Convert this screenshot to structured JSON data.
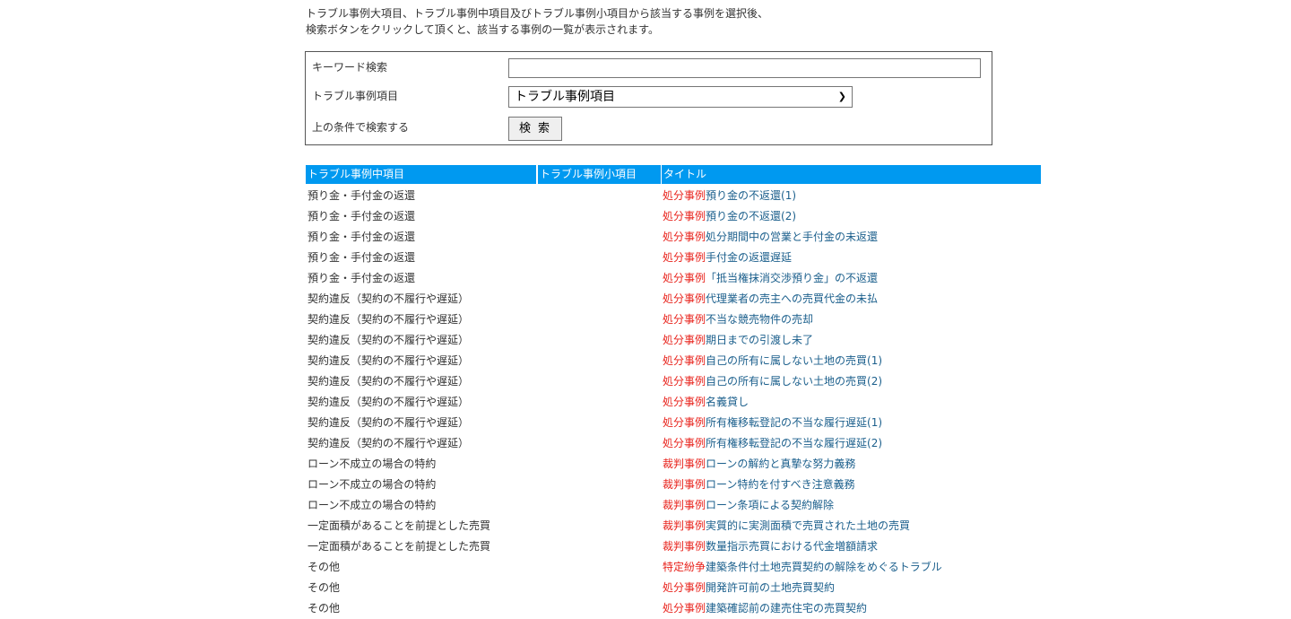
{
  "intro": {
    "line1": "トラブル事例大項目、トラブル事例中項目及びトラブル事例小項目から該当する事例を選択後、",
    "line2": "検索ボタンをクリックして頂くと、該当する事例の一覧が表示されます。"
  },
  "search": {
    "keyword_label": "キーワード検索",
    "keyword_value": "",
    "category_label": "トラブル事例項目",
    "category_selected": "トラブル事例項目",
    "submit_label": "上の条件で検索する",
    "button_label": "検索"
  },
  "table": {
    "headers": [
      "トラブル事例中項目",
      "トラブル事例小項目",
      "タイトル"
    ],
    "rows": [
      {
        "mid": "預り金・手付金の返還",
        "small": "",
        "type": "処分事例",
        "title": "預り金の不返還(1)"
      },
      {
        "mid": "預り金・手付金の返還",
        "small": "",
        "type": "処分事例",
        "title": "預り金の不返還(2)"
      },
      {
        "mid": "預り金・手付金の返還",
        "small": "",
        "type": "処分事例",
        "title": "処分期間中の営業と手付金の未返還"
      },
      {
        "mid": "預り金・手付金の返還",
        "small": "",
        "type": "処分事例",
        "title": "手付金の返還遅延"
      },
      {
        "mid": "預り金・手付金の返還",
        "small": "",
        "type": "処分事例",
        "title": "「抵当権抹消交渉預り金」の不返還"
      },
      {
        "mid": "契約違反（契約の不履行や遅延）",
        "small": "",
        "type": "処分事例",
        "title": "代理業者の売主への売買代金の未払"
      },
      {
        "mid": "契約違反（契約の不履行や遅延）",
        "small": "",
        "type": "処分事例",
        "title": "不当な競売物件の売却"
      },
      {
        "mid": "契約違反（契約の不履行や遅延）",
        "small": "",
        "type": "処分事例",
        "title": "期日までの引渡し未了"
      },
      {
        "mid": "契約違反（契約の不履行や遅延）",
        "small": "",
        "type": "処分事例",
        "title": "自己の所有に属しない土地の売買(1)"
      },
      {
        "mid": "契約違反（契約の不履行や遅延）",
        "small": "",
        "type": "処分事例",
        "title": "自己の所有に属しない土地の売買(2)"
      },
      {
        "mid": "契約違反（契約の不履行や遅延）",
        "small": "",
        "type": "処分事例",
        "title": "名義貸し"
      },
      {
        "mid": "契約違反（契約の不履行や遅延）",
        "small": "",
        "type": "処分事例",
        "title": "所有権移転登記の不当な履行遅延(1)"
      },
      {
        "mid": "契約違反（契約の不履行や遅延）",
        "small": "",
        "type": "処分事例",
        "title": "所有権移転登記の不当な履行遅延(2)"
      },
      {
        "mid": "ローン不成立の場合の特約",
        "small": "",
        "type": "裁判事例",
        "title": "ローンの解約と真摯な努力義務"
      },
      {
        "mid": "ローン不成立の場合の特約",
        "small": "",
        "type": "裁判事例",
        "title": "ローン特約を付すべき注意義務"
      },
      {
        "mid": "ローン不成立の場合の特約",
        "small": "",
        "type": "裁判事例",
        "title": "ローン条項による契約解除"
      },
      {
        "mid": "一定面積があることを前提とした売買",
        "small": "",
        "type": "裁判事例",
        "title": "実質的に実測面積で売買された土地の売買"
      },
      {
        "mid": "一定面積があることを前提とした売買",
        "small": "",
        "type": "裁判事例",
        "title": "数量指示売買における代金増額請求"
      },
      {
        "mid": "その他",
        "small": "",
        "type": "特定紛争",
        "title": "建築条件付土地売買契約の解除をめぐるトラブル"
      },
      {
        "mid": "その他",
        "small": "",
        "type": "処分事例",
        "title": "開発許可前の土地売買契約"
      },
      {
        "mid": "その他",
        "small": "",
        "type": "処分事例",
        "title": "建築確認前の建売住宅の売買契約"
      }
    ]
  },
  "colors": {
    "header_bg": "#0099f0",
    "type_text": "#e8221b",
    "title_link": "#1b5f8c"
  }
}
